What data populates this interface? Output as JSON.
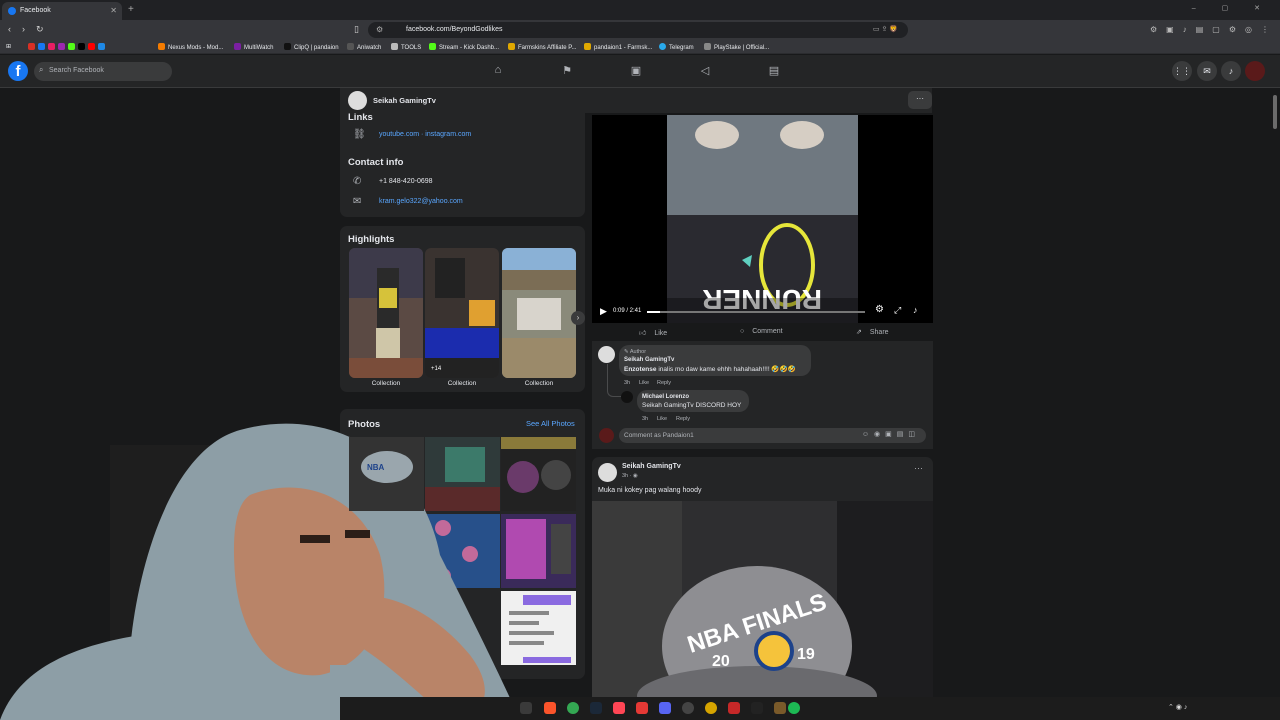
{
  "browser": {
    "tab_title": "Facebook",
    "url": "facebook.com/BeyondGodlikes",
    "bookmarks": [
      "Nexus Mods - Mod...",
      "MultiWatch",
      "ClipQ | pandaion",
      "Aniwatch",
      "TOOLS",
      "Stream - Kick Dashb...",
      "Farmskins Affiliate P...",
      "pandaion1 - Farmsk...",
      "Telegram",
      "PlayStake | Official..."
    ]
  },
  "facebook": {
    "search_placeholder": "Search Facebook"
  },
  "profile": {
    "name": "Seikah GamingTv",
    "links_title": "Links",
    "links": "youtube.com · instagram.com",
    "contact_title": "Contact info",
    "phone": "+1 848-420-0698",
    "email": "kram.gelo322@yahoo.com",
    "highlights_title": "Highlights",
    "highlights": [
      {
        "label": "Collection",
        "badge": ""
      },
      {
        "label": "Collection",
        "badge": "+14"
      },
      {
        "label": "Collection",
        "badge": ""
      }
    ],
    "photos_title": "Photos",
    "see_all": "See All Photos"
  },
  "video": {
    "time": "0:09 / 2:41",
    "progress": 0.06,
    "actions": {
      "like": "Like",
      "comment": "Comment",
      "share": "Share"
    }
  },
  "comments": [
    {
      "badge": "Author",
      "author": "Seikah GamingTv",
      "mention": "Enzotense",
      "text": "inalis mo daw kame ehhh hahahaah!!!! 🤣🤣🤣",
      "time": "3h",
      "like": "Like",
      "reply": "Reply"
    },
    {
      "author": "Michael Lorenzo",
      "mention": "Seikah GamingTv",
      "text": "DISCORD HOY",
      "time": "3h",
      "like": "Like",
      "reply": "Reply"
    }
  ],
  "comment_input": {
    "placeholder": "Comment as Pandaion1"
  },
  "post": {
    "author": "Seikah GamingTv",
    "time": "3h",
    "text": "Muka ni kokey pag walang hoody"
  }
}
